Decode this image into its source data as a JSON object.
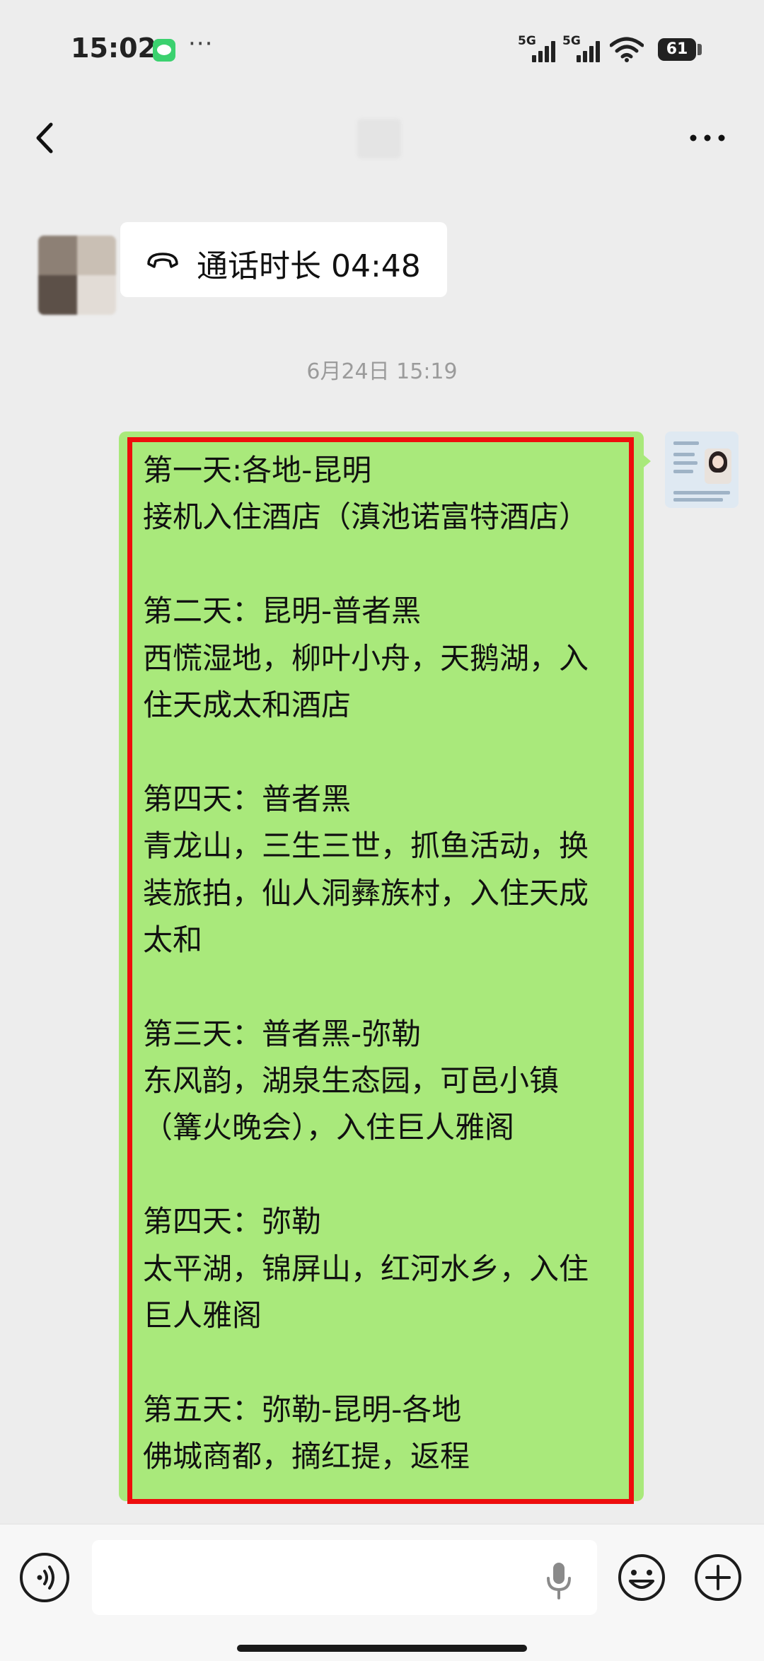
{
  "status_bar": {
    "time": "15:02",
    "more_dots": "···",
    "signal_1_label": "5G",
    "signal_2_label": "5G",
    "battery": "61",
    "wechat_color": "#3bd16f"
  },
  "nav": {
    "back_icon": "chevron-left-icon",
    "more_icon": "more-dots-icon"
  },
  "call_message": {
    "icon": "phone-hangup-icon",
    "text": "通话时长 04:48"
  },
  "timestamp": "6月24日 15:19",
  "itinerary_message": {
    "bubble_color": "#a9e97b",
    "frame_color": "#ee0d0d",
    "lines": [
      "第一天:各地-昆明",
      "接机入住酒店（滇池诺富特酒店）",
      "",
      "第二天：昆明-普者黑",
      "西慌湿地，柳叶小舟，天鹅湖，入",
      "住天成太和酒店",
      "",
      "第四天：普者黑",
      "青龙山，三生三世，抓鱼活动，换",
      "装旅拍，仙人洞彝族村，入住天成",
      "太和",
      "",
      "第三天：普者黑-弥勒",
      "东风韵，湖泉生态园，可邑小镇",
      "（篝火晚会），入住巨人雅阁",
      "",
      "第四天：弥勒",
      "太平湖，锦屏山，红河水乡，入住",
      "巨人雅阁",
      "",
      "第五天：弥勒-昆明-各地",
      "佛城商都，摘红提，返程"
    ]
  },
  "input_bar": {
    "voice_icon": "voice-icon",
    "text_value": "",
    "mic_icon": "microphone-icon",
    "emoji_icon": "emoji-icon",
    "plus_icon": "plus-icon"
  }
}
